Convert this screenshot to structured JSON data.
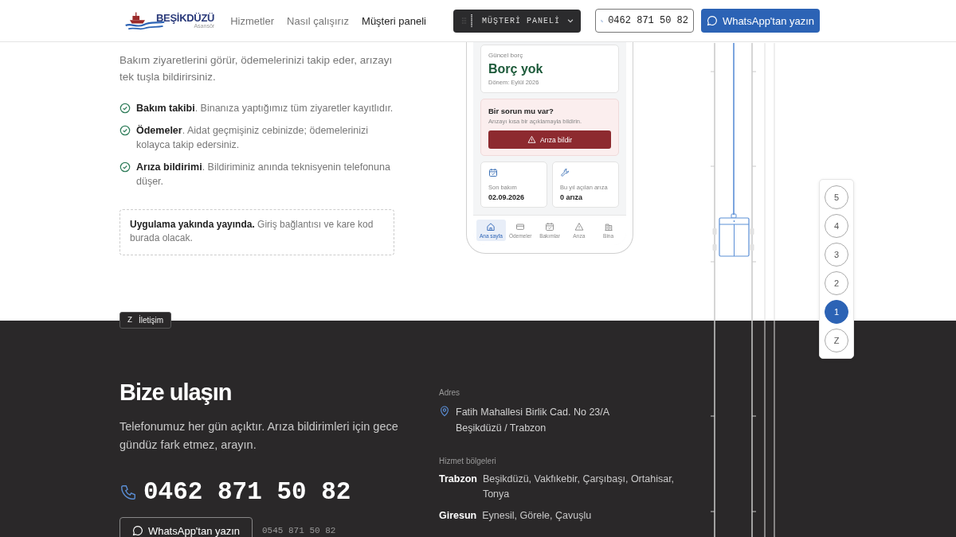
{
  "header": {
    "logo": {
      "name": "BEŞİKDÜZÜ",
      "subtitle": "Asansör"
    },
    "nav": [
      {
        "label": "Hizmetler",
        "selected": false
      },
      {
        "label": "Nasıl çalışırız",
        "selected": false
      },
      {
        "label": "Müşteri paneli",
        "selected": true
      }
    ],
    "panel_button": "MÜŞTERİ PANELİ",
    "phone_button": "0462 871 50 82",
    "whatsapp_button": "WhatsApp'tan yazın"
  },
  "intro": {
    "paragraph_lines": [
      "Bakım ziyaretlerini görür, ödemelerinizi takip eder, arızayı",
      "tek tuşla bildirirsiniz."
    ],
    "features": [
      "**Bakım takibi**. Binanıza yaptığımız tüm ziyaretler kayıtlıdır.",
      "**Ödemeler**. Aidat geçmişiniz cebinizde; ödemelerinizi kolayca takip edersiniz.",
      "**Arıza bildirimi**. Bildiriminiz anında teknisyenin telefonuna düşer."
    ],
    "note": "**Uygulama yakında yayında.** Giriş bağlantısı ve kare kod burada olacak."
  },
  "app": {
    "balance": {
      "label": "Güncel borç",
      "value": "Borç yok",
      "period": "Dönem: Eylül 2026"
    },
    "issue": {
      "title": "Bir sorun mu var?",
      "description": "Arızayı kısa bir açıklamayla bildirin.",
      "button": "Arıza bildir"
    },
    "stats": [
      {
        "kind": "calendar",
        "label": "Son bakım",
        "value": "02.09.2026"
      },
      {
        "kind": "wrench",
        "label": "Bu yıl açılan arıza",
        "value": "0 arıza"
      }
    ],
    "tabs": [
      {
        "kind": "home",
        "label": "Ana sayfa",
        "selected": true
      },
      {
        "kind": "card",
        "label": "Ödemeler",
        "selected": false
      },
      {
        "kind": "calendar",
        "label": "Bakımlar",
        "selected": false
      },
      {
        "kind": "warning",
        "label": "Arıza",
        "selected": false
      },
      {
        "kind": "building",
        "label": "Bina",
        "selected": false
      }
    ]
  },
  "floors": [
    {
      "label": "5",
      "selected": false
    },
    {
      "label": "4",
      "selected": false
    },
    {
      "label": "3",
      "selected": false
    },
    {
      "label": "2",
      "selected": false
    },
    {
      "label": "1",
      "selected": true
    },
    {
      "label": "Z",
      "selected": false
    }
  ],
  "contact": {
    "section_tag": {
      "floor": "Z",
      "label": "İletişim"
    },
    "title": "Bize ulaşın",
    "text": "Telefonumuz her gün açıktır. Arıza bildirimleri için gece gündüz fark etmez, arayın.",
    "phone": "0462 871 50 82",
    "whatsapp_button": "WhatsApp'tan yazın",
    "second_phone": "0545 871 50 82",
    "address_label": "Adres",
    "address_lines": [
      "Fatih Mahallesi Birlik Cad. No 23/A",
      "Beşikdüzü / Trabzon"
    ],
    "regions_label": "Hizmet bölgeleri",
    "regions": [
      {
        "city": "Trabzon",
        "districts": "Beşikdüzü, Vakfıkebir, Çarşıbaşı, Ortahisar, Tonya"
      },
      {
        "city": "Giresun",
        "districts": "Eynesil, Görele, Çavuşlu"
      }
    ]
  }
}
